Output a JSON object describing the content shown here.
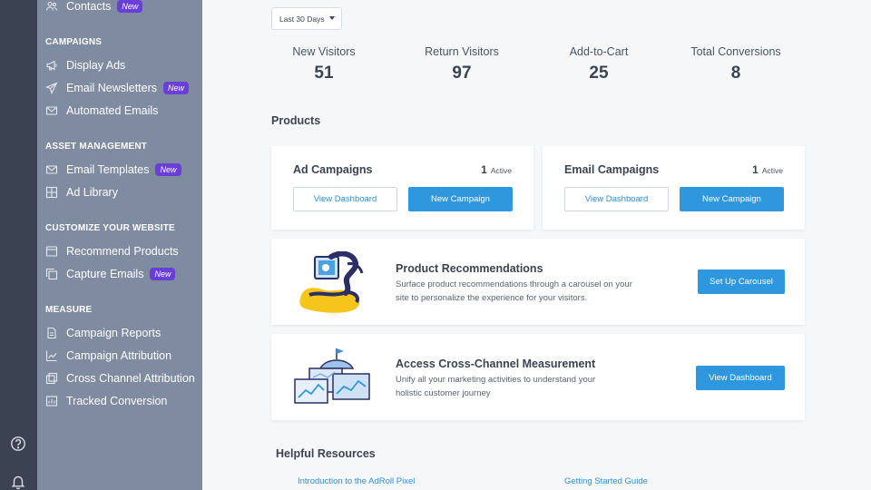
{
  "sidebar": {
    "contacts": {
      "label": "Contacts",
      "badge": "New"
    },
    "sections": [
      {
        "header": "CAMPAIGNS",
        "items": [
          {
            "label": "Display Ads",
            "icon": "megaphone-icon"
          },
          {
            "label": "Email Newsletters",
            "icon": "paper-plane-icon",
            "badge": "New"
          },
          {
            "label": "Automated Emails",
            "icon": "envelope-icon"
          }
        ]
      },
      {
        "header": "ASSET MANAGEMENT",
        "items": [
          {
            "label": "Email Templates",
            "icon": "envelope-icon",
            "badge": "New"
          },
          {
            "label": "Ad Library",
            "icon": "grid-icon"
          }
        ]
      },
      {
        "header": "CUSTOMIZE YOUR WEBSITE",
        "items": [
          {
            "label": "Recommend Products",
            "icon": "browser-icon"
          },
          {
            "label": "Capture Emails",
            "icon": "copy-icon",
            "badge": "New"
          }
        ]
      },
      {
        "header": "MEASURE",
        "items": [
          {
            "label": "Campaign Reports",
            "icon": "document-icon"
          },
          {
            "label": "Campaign Attribution",
            "icon": "line-chart-icon"
          },
          {
            "label": "Cross Channel Attribution",
            "icon": "layers-icon"
          },
          {
            "label": "Tracked Conversion",
            "icon": "report-icon"
          }
        ]
      }
    ]
  },
  "filter": {
    "date_range": "Last 30 Days"
  },
  "stats": [
    {
      "label": "New Visitors",
      "value": "51"
    },
    {
      "label": "Return Visitors",
      "value": "97"
    },
    {
      "label": "Add-to-Cart",
      "value": "25"
    },
    {
      "label": "Total Conversions",
      "value": "8"
    }
  ],
  "products_title": "Products",
  "ad_card": {
    "title": "Ad Campaigns",
    "count": "1",
    "count_label": "Active",
    "view_label": "View Dashboard",
    "new_label": "New Campaign"
  },
  "email_card": {
    "title": "Email Campaigns",
    "count": "1",
    "count_label": "Active",
    "view_label": "View Dashboard",
    "new_label": "New Campaign"
  },
  "recommend_card": {
    "title": "Product Recommendations",
    "desc": "Surface product recommendations through a carousel on your site to personalize the experience for your visitors.",
    "button": "Set Up Carousel"
  },
  "measure_card": {
    "title": "Access Cross-Channel Measurement",
    "desc": "Unify all your marketing activities to understand your holistic customer journey",
    "button": "View Dashboard"
  },
  "resources": {
    "title": "Helpful Resources",
    "links": [
      "Introduction to the AdRoll Pixel",
      "Getting Started Guide"
    ]
  },
  "colors": {
    "rail": "#3b4353",
    "sidebar": "#7f8ba1",
    "badge": "#6a3fd8",
    "primary": "#2f97dd"
  }
}
